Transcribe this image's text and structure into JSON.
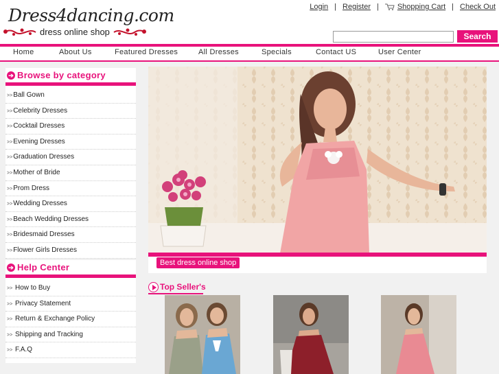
{
  "header": {
    "logo": {
      "title": "Dress4dancing.com",
      "subtitle": "dress online shop"
    },
    "links": {
      "login": "Login",
      "register": "Register",
      "cart": "Shopping Cart",
      "checkout": "Check Out",
      "separator": "|"
    },
    "search": {
      "value": "",
      "button": "Search"
    }
  },
  "nav": {
    "items": [
      "Home",
      "About Us",
      "Featured Dresses",
      "All Dresses",
      "Specials",
      "Contact US",
      "User Center"
    ]
  },
  "sidebar": {
    "browse_title": "Browse by category",
    "categories": [
      "Ball Gown",
      "Celebrity Dresses",
      "Cocktail Dresses",
      "Evening Dresses",
      "Graduation Dresses",
      "Mother of Bride",
      "Prom Dress",
      "Wedding Dresses",
      "Beach Wedding Dresses",
      "Bridesmaid Dresses",
      "Flower Girls Dresses"
    ],
    "help_title": "Help Center",
    "help_items": [
      "How to Buy",
      "Privacy Statement",
      "Return & Exchange Policy",
      "Shipping and Tracking",
      "F.A.Q"
    ],
    "bullet": ">>"
  },
  "banner": {
    "caption": "Best dress online shop"
  },
  "top_sellers": {
    "title": "Top Seller's"
  },
  "colors": {
    "accent": "#e8127b",
    "background": "#f1f1f1"
  }
}
